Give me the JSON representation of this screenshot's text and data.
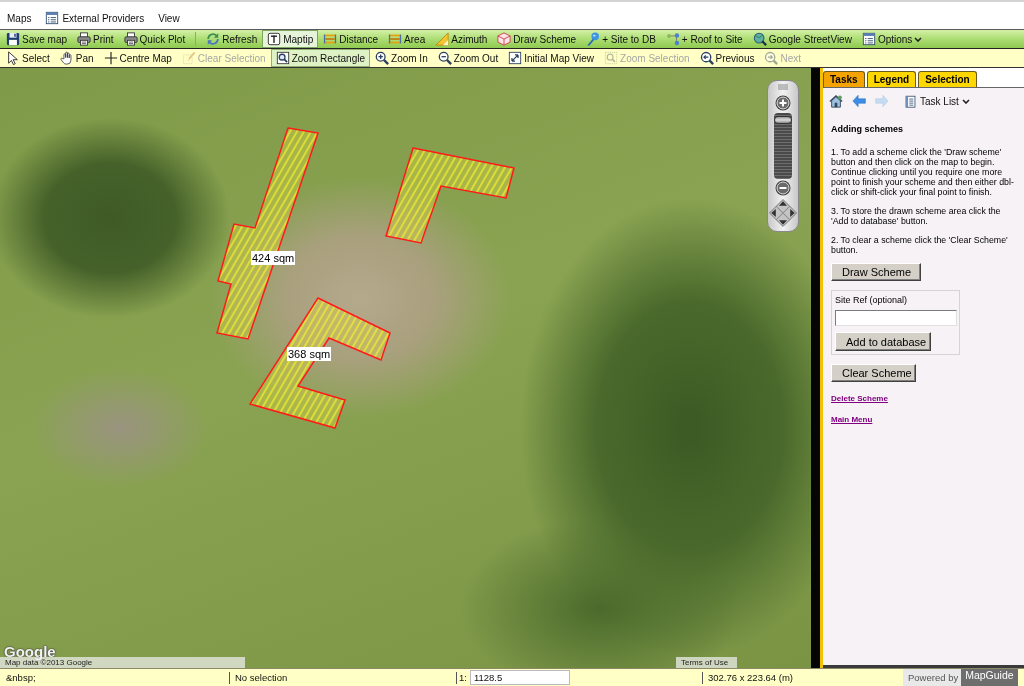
{
  "menu_bar": [
    {
      "label": "Maps",
      "kind": "text"
    },
    {
      "label": "External Providers",
      "kind": "icon_text"
    },
    {
      "label": "View",
      "kind": "text"
    }
  ],
  "toolbar_main": {
    "groups": [
      {
        "items": [
          {
            "label": "Save map",
            "kind": "button",
            "selected": false
          },
          {
            "label": "Print",
            "kind": "button",
            "selected": false
          },
          {
            "label": "Quick Plot",
            "kind": "button",
            "selected": false
          }
        ]
      },
      {
        "items": [
          {
            "label": "Refresh",
            "kind": "button",
            "selected": false
          },
          {
            "label": "Maptip",
            "kind": "button",
            "selected": true
          },
          {
            "label": "Distance",
            "kind": "button",
            "selected": false
          },
          {
            "label": "Area",
            "kind": "button",
            "selected": false
          },
          {
            "label": "Azimuth",
            "kind": "button",
            "selected": false
          },
          {
            "label": "Draw Scheme",
            "kind": "button",
            "selected": false
          },
          {
            "label": "+ Site to DB",
            "kind": "button",
            "selected": false
          },
          {
            "label": "+ Roof to Site",
            "kind": "button",
            "selected": false
          },
          {
            "label": "Google StreetView",
            "kind": "button",
            "selected": false
          },
          {
            "label": "Options",
            "kind": "menu",
            "selected": false
          }
        ]
      }
    ]
  },
  "toolbar_nav": {
    "items": [
      {
        "label": "Select",
        "selected": false,
        "disabled": false
      },
      {
        "label": "Pan",
        "selected": false,
        "disabled": false
      },
      {
        "label": "Centre Map",
        "selected": false,
        "disabled": false
      },
      {
        "label": "Clear Selection",
        "selected": false,
        "disabled": true
      },
      {
        "label": "Zoom Rectangle",
        "selected": true,
        "disabled": false
      },
      {
        "label": "Zoom In",
        "selected": false,
        "disabled": false
      },
      {
        "label": "Zoom Out",
        "selected": false,
        "disabled": false
      },
      {
        "label": "Initial Map View",
        "selected": false,
        "disabled": false
      },
      {
        "label": "Zoom Selection",
        "selected": false,
        "disabled": true
      },
      {
        "label": "Previous",
        "selected": false,
        "disabled": false
      },
      {
        "label": "Next",
        "selected": false,
        "disabled": true
      }
    ]
  },
  "map": {
    "schemes": [
      {
        "kind": "labelled",
        "area": "424 sqm"
      },
      {
        "kind": "plain"
      },
      {
        "kind": "labelled",
        "area": "368 sqm"
      }
    ],
    "zoom_slider": {
      "level": 0.95
    },
    "logo": "Google",
    "attribution": "Map data ©2013 Google",
    "terms_link": "Terms of Use"
  },
  "side_panel": {
    "tabs": [
      {
        "label": "Tasks",
        "selected": true
      },
      {
        "label": "Legend",
        "selected": false
      },
      {
        "label": "Selection",
        "selected": false
      }
    ],
    "nav": [
      {
        "kind": "home"
      },
      {
        "kind": "back",
        "disabled": false
      },
      {
        "kind": "forward",
        "disabled": true
      },
      {
        "kind": "task_list",
        "label": "Task List"
      }
    ],
    "heading": "Adding schemes",
    "paragraphs": [
      "1. To add a scheme click the 'Draw scheme' button and then click on the map to begin. Continue clicking until you require one more point to finish your scheme and then either dbl-click or shift-click your final point to finish.",
      "3. To store the drawn scheme area click the 'Add to database' button.",
      "2. To clear a scheme click the 'Clear Scheme' button."
    ],
    "draw_button": "Draw Scheme",
    "site_ref": {
      "label": "Site Ref (optional)",
      "button": "Add to database"
    },
    "clear_button": "Clear Scheme",
    "links": [
      "Delete Scheme",
      "Main Menu"
    ]
  },
  "status_bar": {
    "message": "&nbsp;",
    "selection": "No selection",
    "scale_prefix": "1:",
    "scale": "1128.5",
    "extent": "302.76 x 223.64 (m)",
    "powered_by": "Powered by",
    "product": "MapGuide"
  }
}
